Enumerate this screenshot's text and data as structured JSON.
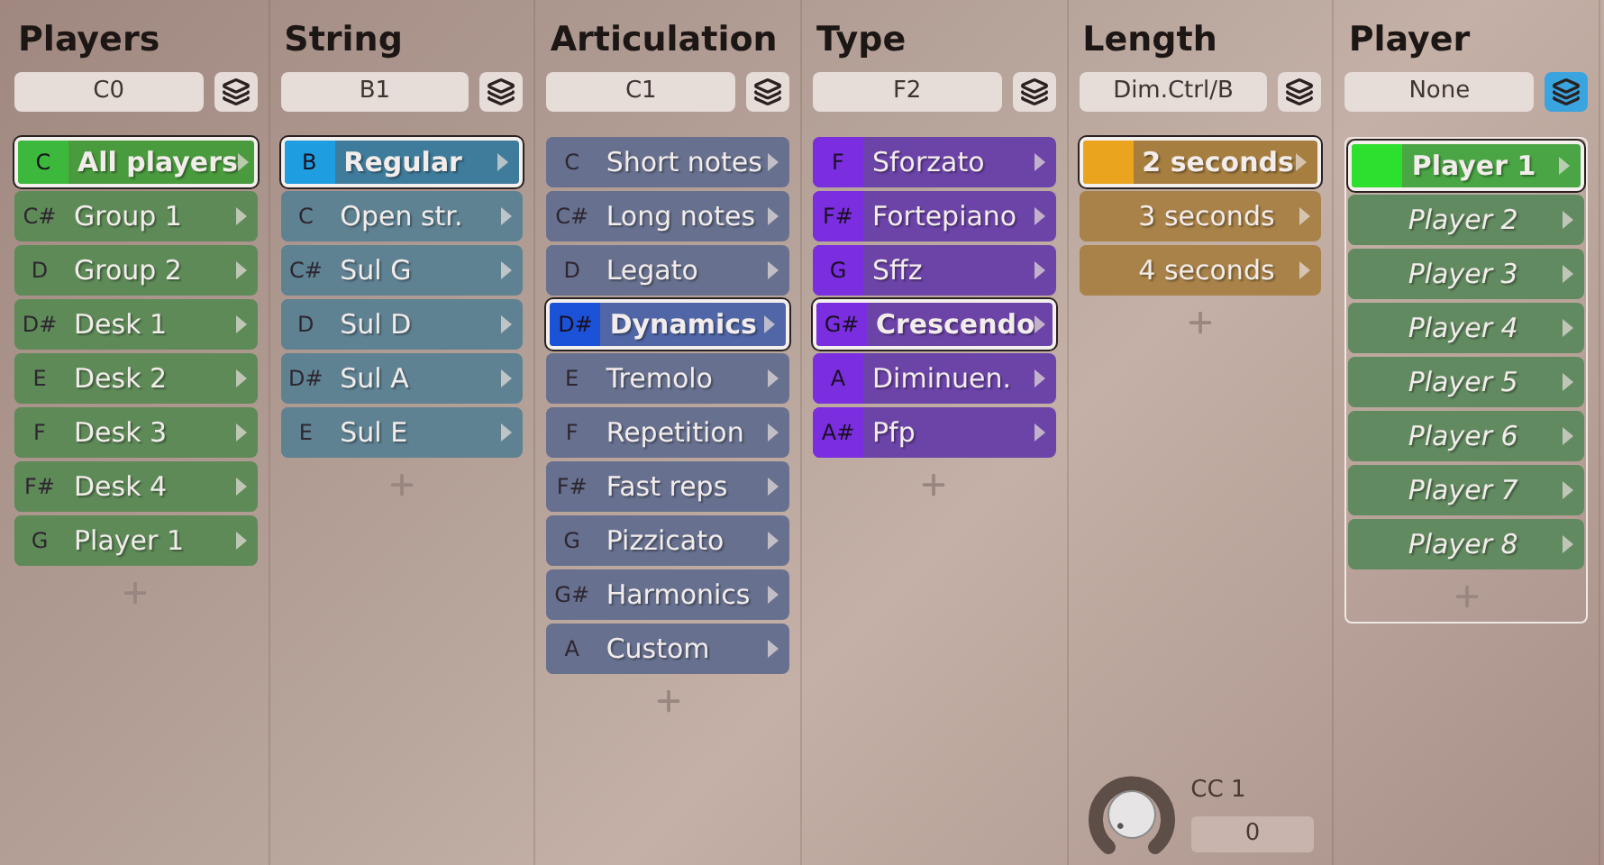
{
  "columns": [
    {
      "title": "Players",
      "selector": "C0",
      "layers_on": false,
      "kind": "keyswitch",
      "color": "#3cb83c",
      "items": [
        {
          "key": "C",
          "label": "All players",
          "selected": true
        },
        {
          "key": "C#",
          "label": "Group 1",
          "selected": false
        },
        {
          "key": "D",
          "label": "Group 2",
          "selected": false
        },
        {
          "key": "D#",
          "label": "Desk 1",
          "selected": false
        },
        {
          "key": "E",
          "label": "Desk 2",
          "selected": false
        },
        {
          "key": "F",
          "label": "Desk 3",
          "selected": false
        },
        {
          "key": "F#",
          "label": "Desk 4",
          "selected": false
        },
        {
          "key": "G",
          "label": "Player 1",
          "selected": false
        }
      ]
    },
    {
      "title": "String",
      "selector": "B1",
      "layers_on": false,
      "kind": "keyswitch",
      "color": "#1e9ee0",
      "items": [
        {
          "key": "B",
          "label": "Regular",
          "selected": true
        },
        {
          "key": "C",
          "label": "Open str.",
          "selected": false
        },
        {
          "key": "C#",
          "label": "Sul G",
          "selected": false
        },
        {
          "key": "D",
          "label": "Sul D",
          "selected": false
        },
        {
          "key": "D#",
          "label": "Sul A",
          "selected": false
        },
        {
          "key": "E",
          "label": "Sul E",
          "selected": false
        }
      ]
    },
    {
      "title": "Articulation",
      "selector": "C1",
      "layers_on": false,
      "kind": "keyswitch",
      "color": "#1c52d8",
      "items": [
        {
          "key": "C",
          "label": "Short notes",
          "selected": false
        },
        {
          "key": "C#",
          "label": "Long notes",
          "selected": false
        },
        {
          "key": "D",
          "label": "Legato",
          "selected": false
        },
        {
          "key": "D#",
          "label": "Dynamics",
          "selected": true
        },
        {
          "key": "E",
          "label": "Tremolo",
          "selected": false
        },
        {
          "key": "F",
          "label": "Repetition",
          "selected": false
        },
        {
          "key": "F#",
          "label": "Fast reps",
          "selected": false
        },
        {
          "key": "G",
          "label": "Pizzicato",
          "selected": false
        },
        {
          "key": "G#",
          "label": "Harmonics",
          "selected": false
        },
        {
          "key": "A",
          "label": "Custom",
          "selected": false
        }
      ]
    },
    {
      "title": "Type",
      "selector": "F2",
      "layers_on": false,
      "kind": "keyswitch",
      "color": "#7a2ee0",
      "items": [
        {
          "key": "F",
          "label": "Sforzato",
          "selected": false
        },
        {
          "key": "F#",
          "label": "Fortepiano",
          "selected": false
        },
        {
          "key": "G",
          "label": "Sffz",
          "selected": false
        },
        {
          "key": "G#",
          "label": "Crescendo",
          "selected": true
        },
        {
          "key": "A",
          "label": "Diminuen.",
          "selected": false
        },
        {
          "key": "A#",
          "label": "Pfp",
          "selected": false
        }
      ]
    },
    {
      "title": "Length",
      "selector": "Dim.Ctrl/B",
      "layers_on": false,
      "kind": "length",
      "color": "#eba41e",
      "items": [
        {
          "label": "2 seconds",
          "selected": true
        },
        {
          "label": "3 seconds",
          "selected": false
        },
        {
          "label": "4 seconds",
          "selected": false
        }
      ],
      "knob": {
        "label": "CC 1",
        "value": "0"
      }
    },
    {
      "title": "Player",
      "selector": "None",
      "layers_on": true,
      "kind": "player",
      "color": "#2ee02e",
      "items": [
        {
          "label": "Player 1",
          "selected": true
        },
        {
          "label": "Player 2",
          "selected": false
        },
        {
          "label": "Player 3",
          "selected": false
        },
        {
          "label": "Player 4",
          "selected": false
        },
        {
          "label": "Player 5",
          "selected": false
        },
        {
          "label": "Player 6",
          "selected": false
        },
        {
          "label": "Player 7",
          "selected": false
        },
        {
          "label": "Player 8",
          "selected": false
        }
      ]
    }
  ]
}
